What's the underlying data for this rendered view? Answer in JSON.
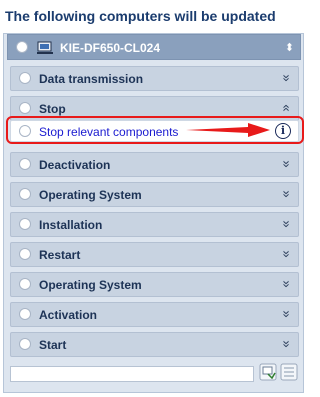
{
  "title": "The following computers will be updated",
  "computer": {
    "name": "KIE-DF650-CL024",
    "icon": "computer-monitor-icon",
    "chevron": "collapse-expand-icon"
  },
  "steps": [
    {
      "label": "Data transmission",
      "expanded": false
    },
    {
      "label": "Stop",
      "expanded": true,
      "children": [
        {
          "label": "Stop relevant components",
          "icon": "info-icon"
        }
      ]
    },
    {
      "label": "Deactivation",
      "expanded": false
    },
    {
      "label": "Operating System",
      "expanded": false
    },
    {
      "label": "Installation",
      "expanded": false
    },
    {
      "label": "Restart",
      "expanded": false
    },
    {
      "label": "Operating System",
      "expanded": false
    },
    {
      "label": "Activation",
      "expanded": false
    },
    {
      "label": "Start",
      "expanded": false
    }
  ],
  "chevrons": {
    "down": "»",
    "up": "«"
  },
  "info_glyph": "i",
  "annotation": {
    "color": "#e81a1a"
  },
  "footer": {
    "filter_value": "",
    "buttons": [
      "select-all-icon",
      "deselect-all-icon"
    ]
  }
}
